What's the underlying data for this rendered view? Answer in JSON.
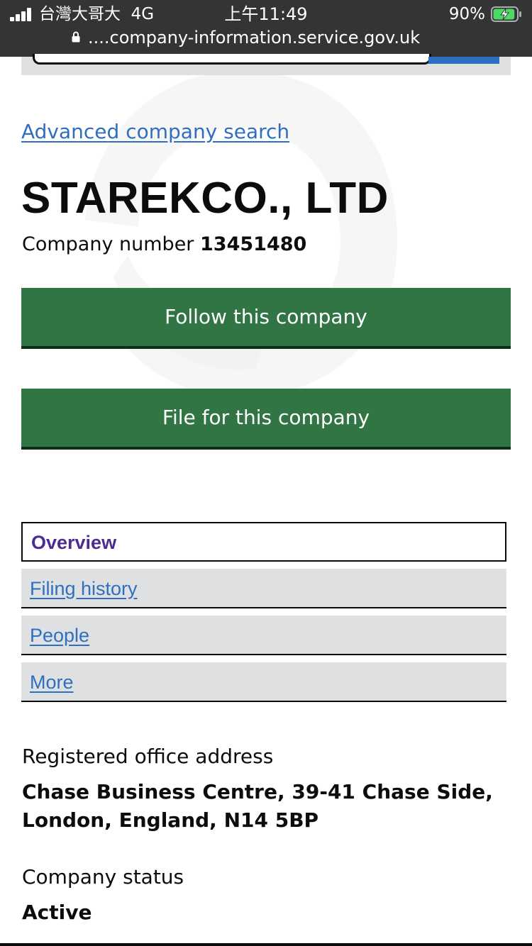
{
  "status_bar": {
    "carrier": "台灣大哥大",
    "network": "4G",
    "time": "上午11:49",
    "battery_percent": "90%",
    "battery_level": 0.9,
    "url": "....company-information.service.gov.uk",
    "icons": [
      "signal-icon",
      "lock-icon",
      "battery-charging-icon"
    ]
  },
  "search": {
    "input_value": "",
    "button_color": "#2b70c0"
  },
  "advanced_search_link": "Advanced company search",
  "company": {
    "name": "STAREKCO., LTD",
    "number_label": "Company number",
    "number": "13451480"
  },
  "buttons": {
    "follow": "Follow this company",
    "file": "File for this company",
    "color": "#317545"
  },
  "tabs": [
    {
      "label": "Overview",
      "active": true
    },
    {
      "label": "Filing history",
      "active": false
    },
    {
      "label": "People",
      "active": false
    },
    {
      "label": "More",
      "active": false
    }
  ],
  "details": {
    "address_label": "Registered office address",
    "address_line1": "Chase Business Centre, 39-41 Chase Side,",
    "address_line2": "London, England, N14 5BP",
    "status_label": "Company status",
    "status_value": "Active"
  },
  "colors": {
    "link": "#2f6fbf",
    "active_tab_text": "#4c2c92",
    "tab_background": "#dee0e2"
  }
}
